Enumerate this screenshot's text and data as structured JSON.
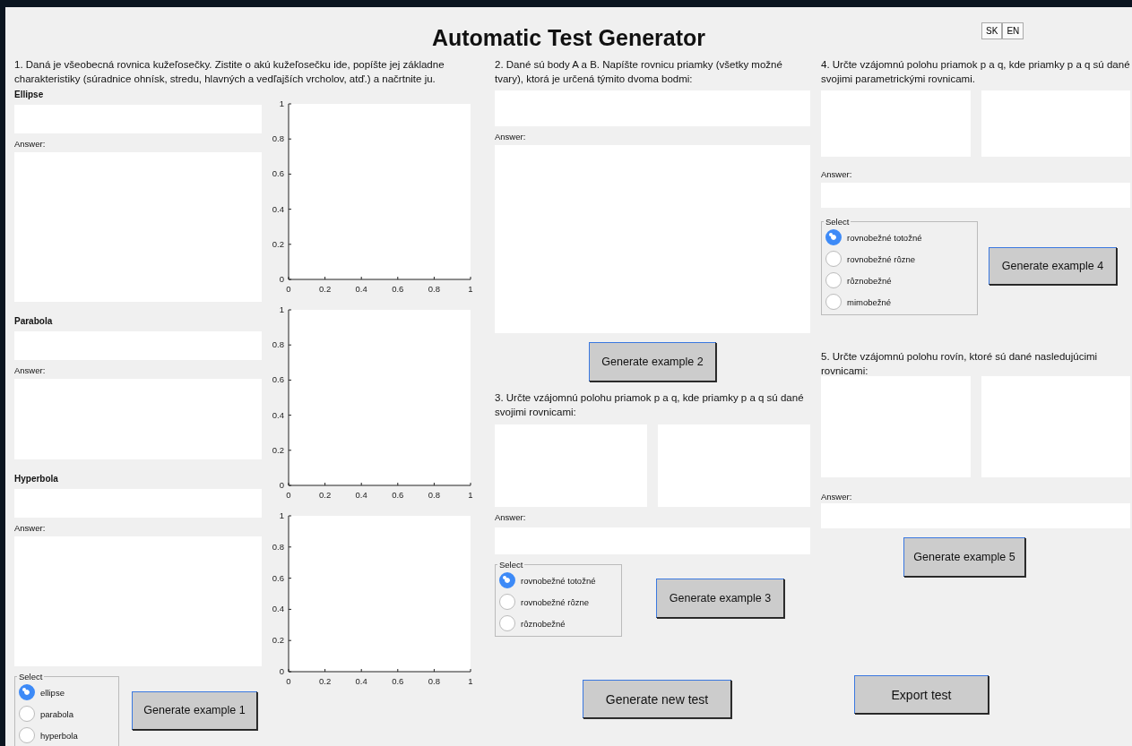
{
  "window": {
    "title": "Automatic Test Generator"
  },
  "language_buttons": [
    "SK",
    "EN"
  ],
  "task1": {
    "question": "1. Daná je všeobecná rovnica kužeľosečky. Zistite o akú kužeľosečku ide, popíšte jej základne charakteristiky (súradnice ohnísk, stredu, hlavných a vedľajších vrcholov, atď.) a načrtnite ju.",
    "sections": [
      {
        "label": "Ellipse",
        "answer_label": "Answer:"
      },
      {
        "label": "Parabola",
        "answer_label": "Answer:"
      },
      {
        "label": "Hyperbola",
        "answer_label": "Answer:"
      }
    ],
    "charts": [
      {
        "chart_data": {
          "type": "line",
          "xlim": [
            0,
            1
          ],
          "ylim": [
            0,
            1
          ],
          "xticks": [
            0,
            0.2,
            0.4,
            0.6,
            0.8,
            1
          ],
          "yticks": [
            0,
            0.2,
            0.4,
            0.6,
            0.8,
            1
          ]
        }
      },
      {
        "chart_data": {
          "type": "line",
          "xlim": [
            0,
            1
          ],
          "ylim": [
            0,
            1
          ],
          "xticks": [
            0,
            0.2,
            0.4,
            0.6,
            0.8,
            1
          ],
          "yticks": [
            0,
            0.2,
            0.4,
            0.6,
            0.8,
            1
          ]
        }
      },
      {
        "chart_data": {
          "type": "line",
          "xlim": [
            0,
            1
          ],
          "ylim": [
            0,
            1
          ],
          "xticks": [
            0,
            0.2,
            0.4,
            0.6,
            0.8,
            1
          ],
          "yticks": [
            0,
            0.2,
            0.4,
            0.6,
            0.8,
            1
          ]
        }
      }
    ],
    "select": {
      "legend": "Select",
      "options": [
        {
          "label": "ellipse",
          "selected": true
        },
        {
          "label": "parabola",
          "selected": false
        },
        {
          "label": "hyperbola",
          "selected": false
        }
      ]
    },
    "button": "Generate example 1"
  },
  "task2": {
    "question": "2. Dané sú body A a B. Napíšte rovnicu priamky (všetky možné tvary), ktorá je určená týmito dvoma bodmi:",
    "answer_label": "Answer:",
    "button": "Generate example 2"
  },
  "task3": {
    "question": "3. Určte vzájomnú polohu priamok p a q, kde priamky p a q sú dané svojimi rovnicami:",
    "answer_label": "Answer:",
    "select": {
      "legend": "Select",
      "options": [
        {
          "label": "rovnobežné totožné",
          "selected": true
        },
        {
          "label": "rovnobežné rôzne",
          "selected": false
        },
        {
          "label": "rôznobežné",
          "selected": false
        }
      ]
    },
    "button": "Generate example 3"
  },
  "task4": {
    "question": "4. Určte vzájomnú polohu priamok p a q, kde priamky p a q sú dané svojimi parametrickými rovnicami.",
    "answer_label": "Answer:",
    "select": {
      "legend": "Select",
      "options": [
        {
          "label": "rovnobežné totožné",
          "selected": true
        },
        {
          "label": "rovnobežné rôzne",
          "selected": false
        },
        {
          "label": "rôznobežné",
          "selected": false
        },
        {
          "label": "mimobežné",
          "selected": false
        }
      ]
    },
    "button": "Generate example 4"
  },
  "task5": {
    "question": "5. Určte vzájomnú polohu rovín, ktoré sú dané nasledujúcimi rovnicami:",
    "answer_label": "Answer:",
    "button": "Generate example 5"
  },
  "footer_buttons": [
    "Generate new test",
    "Export test"
  ]
}
